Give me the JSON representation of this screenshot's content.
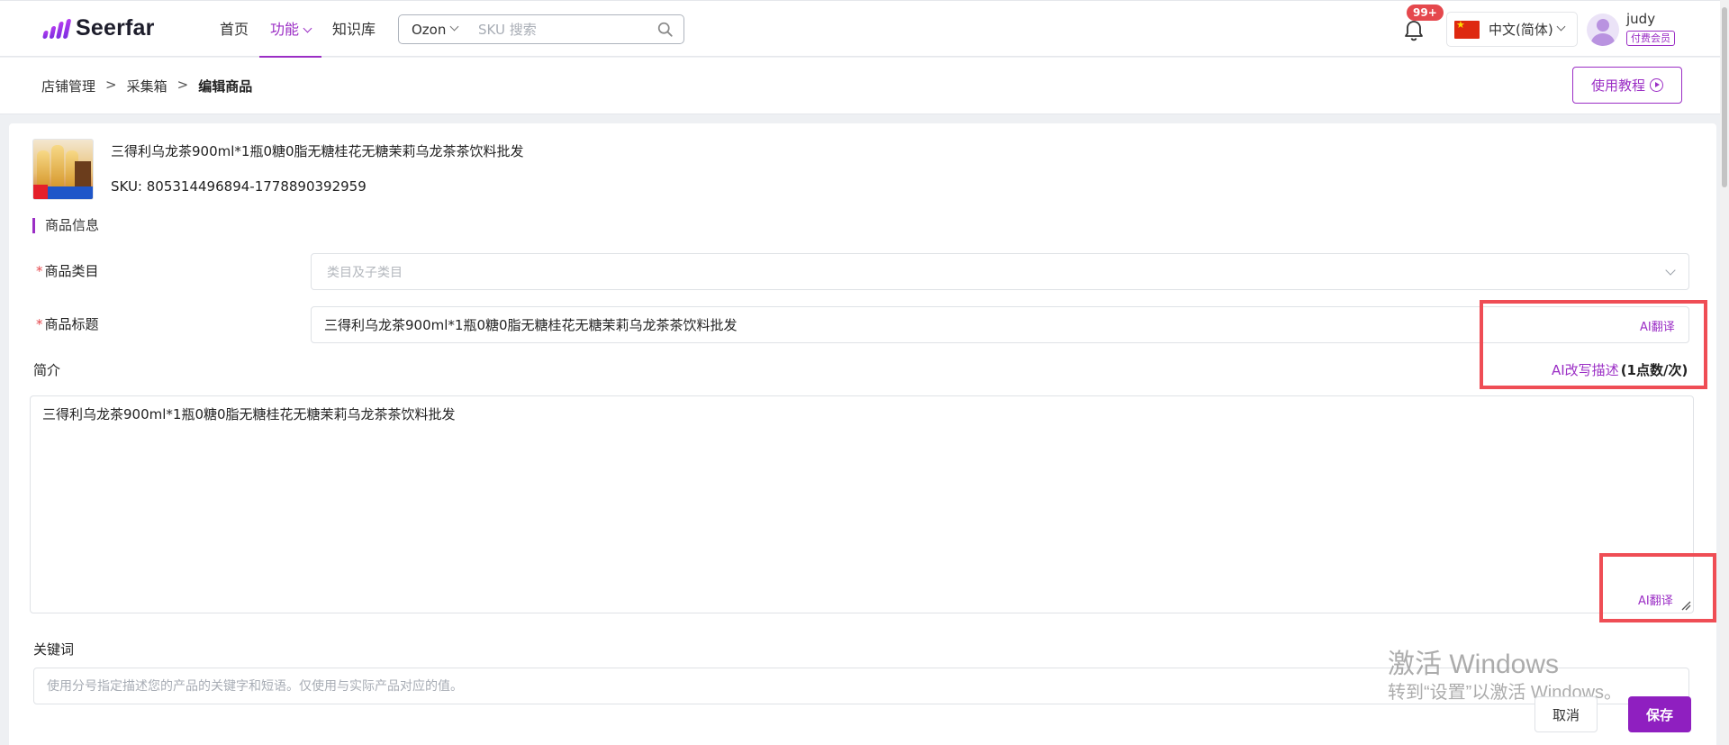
{
  "header": {
    "logo_text": "Seerfar",
    "nav": [
      {
        "label": "首页"
      },
      {
        "label": "功能"
      },
      {
        "label": "知识库"
      }
    ],
    "search": {
      "platform": "Ozon",
      "placeholder": "SKU 搜索"
    },
    "notification_badge": "99+",
    "language": "中文(简体)",
    "username": "judy",
    "member_badge": "付费会员"
  },
  "breadcrumb": {
    "items": [
      "店铺管理",
      "采集箱"
    ],
    "separator": ">",
    "current": "编辑商品",
    "tutorial_label": "使用教程"
  },
  "product": {
    "title": "三得利乌龙茶900ml*1瓶0糖0脂无糖桂花无糖茉莉乌龙茶茶饮料批发",
    "sku": "SKU: 805314496894-1778890392959"
  },
  "form": {
    "section_title": "商品信息",
    "required_mark": "*",
    "category_label": "商品类目",
    "category_placeholder": "类目及子类目",
    "title_label": "商品标题",
    "title_value": "三得利乌龙茶900ml*1瓶0糖0脂无糖桂花无糖茉莉乌龙茶茶饮料批发",
    "ai_translate": "AI翻译",
    "intro_label": "简介",
    "ai_rewrite": "AI改写描述",
    "ai_rewrite_cost": "(1点数/次)",
    "description_value": "三得利乌龙茶900ml*1瓶0糖0脂无糖桂花无糖茉莉乌龙茶茶饮料批发",
    "keywords_label": "关键词",
    "keywords_placeholder": "使用分号指定描述您的产品的关键字和短语。仅使用与实际产品对应的值。"
  },
  "actions": {
    "cancel": "取消",
    "save": "保存"
  },
  "watermark": {
    "line1": "激活 Windows",
    "line2": "转到“设置”以激活 Windows。"
  },
  "colors": {
    "accent": "#9b2ec5",
    "annotation": "#ef4d55",
    "badge": "#e5484d"
  }
}
